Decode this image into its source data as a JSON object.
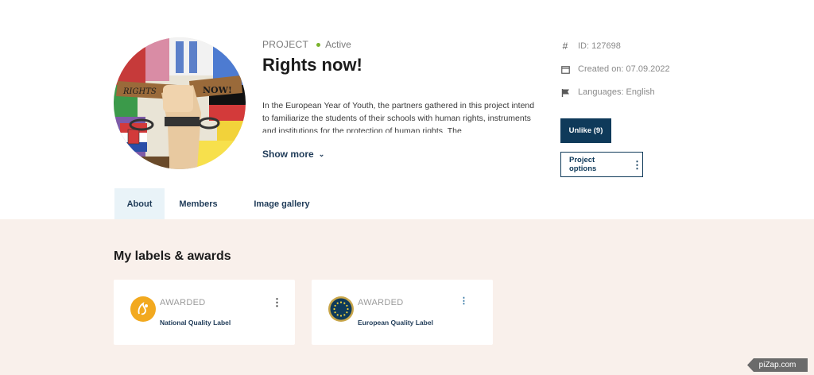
{
  "project": {
    "type_label": "PROJECT",
    "status": "Active",
    "title": "Rights now!",
    "description": "In the European Year of Youth, the partners gathered in this project intend to familiarize the students of their schools with human rights, instruments and institutions for the protection of human rights. The",
    "show_more": "Show more",
    "image_text_1": "RIGHTS",
    "image_text_2": "NOW!"
  },
  "sidebar": {
    "id": "ID: 127698",
    "created": "Created on: 07.09.2022",
    "languages": "Languages: English",
    "unlike_button": "Unlike (9)",
    "options_button": "Project options"
  },
  "tabs": [
    {
      "label": "About"
    },
    {
      "label": "Members"
    },
    {
      "label": "Image gallery"
    }
  ],
  "labels_section": {
    "title": "My labels & awards",
    "cards": [
      {
        "status": "AWARDED",
        "label": "National Quality Label",
        "badge_icon": "national-quality-badge",
        "badge_color": "#f2a91f"
      },
      {
        "status": "AWARDED",
        "label": "European Quality Label",
        "badge_icon": "european-quality-badge",
        "badge_color": "#0f3a5a"
      }
    ]
  },
  "watermark": "piZap.com",
  "colors": {
    "primary": "#0f3a5a",
    "active_dot": "#7ab32c",
    "bottom_bg": "#f9f0eb",
    "tab_active_bg": "#e9f3f8"
  }
}
